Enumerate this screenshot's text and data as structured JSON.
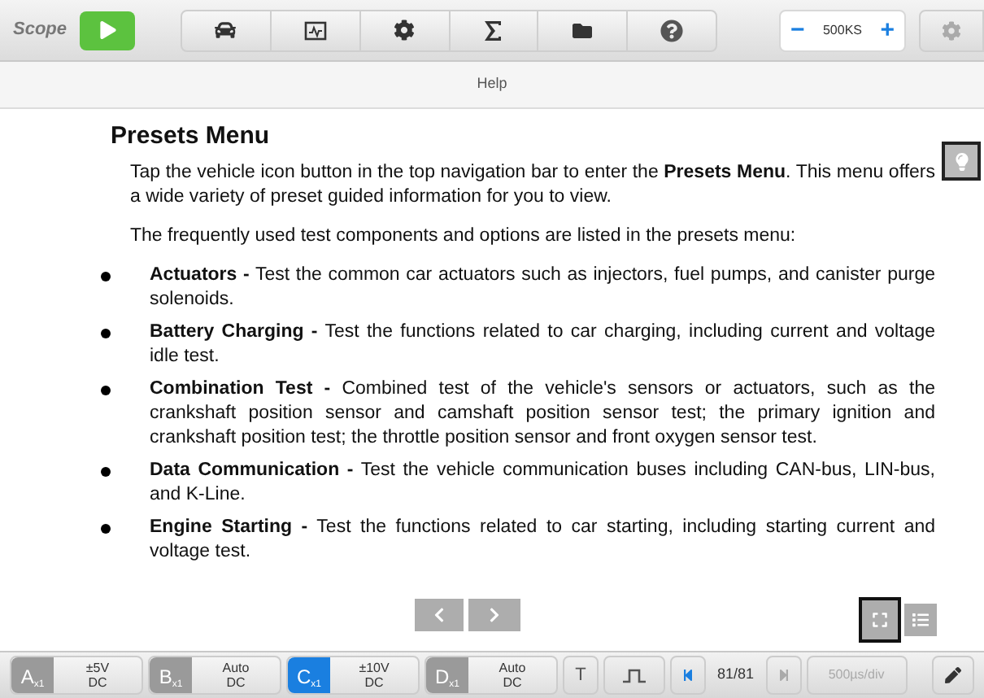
{
  "toolbar": {
    "app_label": "Scope",
    "timebase": {
      "minus": "−",
      "value": "500KS",
      "plus": "+"
    }
  },
  "header": {
    "title": "Help"
  },
  "document": {
    "heading": "Presets Menu",
    "paragraphs": [
      "Tap the vehicle icon button in the top navigation bar to enter the **Presets Menu**. This menu offers a wide variety of preset guided information for you to view.",
      "The frequently used test components and options are listed in the presets menu:"
    ],
    "bullets": [
      "**Actuators -** Test the common car actuators such as injectors, fuel pumps, and canister purge solenoids.",
      "**Battery Charging -** Test the functions related to car charging, including current and voltage idle test.",
      "**Combination Test -** Combined test of the vehicle's sensors or actuators, such as the crankshaft position sensor and camshaft position sensor test; the primary ignition and crankshaft position test; the throttle position sensor and front oxygen sensor test.",
      "**Data Communication -** Test the vehicle communication buses including CAN-bus, LIN-bus, and K-Line.",
      "**Engine Starting -** Test the functions related to car starting, including starting current and voltage test."
    ]
  },
  "channels": [
    {
      "letter": "A",
      "probe": "x1",
      "range": "±5V",
      "coupling": "DC",
      "selected": false
    },
    {
      "letter": "B",
      "probe": "x1",
      "range": "Auto",
      "coupling": "DC",
      "selected": false
    },
    {
      "letter": "C",
      "probe": "x1",
      "range": "±10V",
      "coupling": "DC",
      "selected": true
    },
    {
      "letter": "D",
      "probe": "x1",
      "range": "Auto",
      "coupling": "DC",
      "selected": false
    }
  ],
  "bottom_bar": {
    "trigger_label": "T",
    "frame_counter": "81/81",
    "time_per_div": "500µs/div"
  }
}
